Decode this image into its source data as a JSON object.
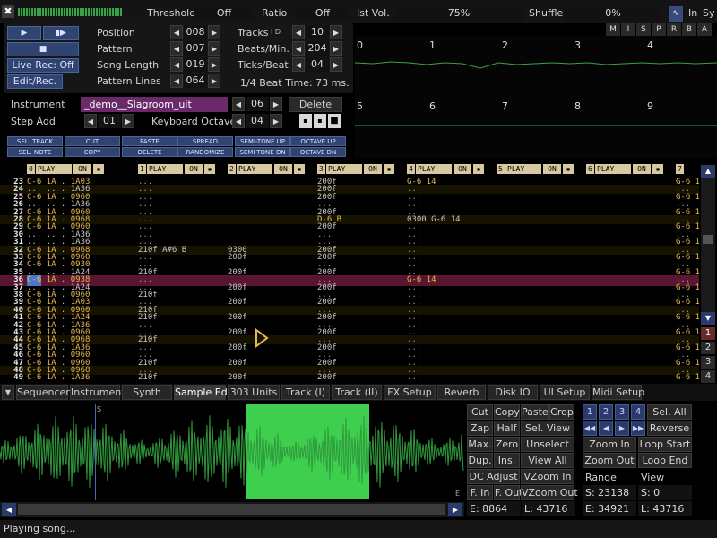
{
  "top_bar": {
    "threshold_label": "Threshold",
    "threshold_value": "Off",
    "ratio_label": "Ratio",
    "ratio_value": "Off",
    "inst_vol_label": "Ist Vol.",
    "inst_vol_value": "75%",
    "shuffle_label": "Shuffle",
    "shuffle_value": "0%",
    "in_label": "In",
    "sy_label": "Sy"
  },
  "transport": {
    "live_rec": "Live Rec: Off",
    "edit_rec": "Edit/Rec."
  },
  "song": {
    "position_label": "Position",
    "position_value": "008",
    "pattern_label": "Pattern",
    "pattern_value": "007",
    "song_length_label": "Song Length",
    "song_length_value": "019",
    "pattern_lines_label": "Pattern Lines",
    "pattern_lines_value": "064",
    "tracks_label": "Tracks",
    "tracks_id": "I D",
    "tracks_value": "10",
    "bpm_label": "Beats/Min.",
    "bpm_value": "204",
    "tpb_label": "Ticks/Beat",
    "tpb_value": "04",
    "beat_time": "1/4 Beat Time: 73 ms."
  },
  "mute_buttons": [
    "M",
    "I",
    "S",
    "P",
    "R",
    "B",
    "A"
  ],
  "scope_track_numbers_top": [
    "0",
    "1",
    "2",
    "3",
    "4"
  ],
  "scope_track_numbers_bottom": [
    "5",
    "6",
    "7",
    "8",
    "9"
  ],
  "instrument": {
    "label": "Instrument",
    "name": "_demo__Slagroom_uit",
    "number": "06",
    "delete": "Delete",
    "step_add_label": "Step Add",
    "step_add_value": "01",
    "kbd_octave_label": "Keyboard Octave",
    "kbd_octave_value": "04"
  },
  "edit_buttons": [
    {
      "top": "SEL. TRACK",
      "bottom": "SEL. NOTE"
    },
    {
      "top": "CUT",
      "bottom": "COPY"
    },
    {
      "top": "PASTE",
      "bottom": "DELETE"
    },
    {
      "top": "SPREAD",
      "bottom": "RANDOMIZE"
    },
    {
      "top": "SEMI-TONE UP",
      "bottom": "SEMI-TONE DN"
    },
    {
      "top": "OCTAVE UP",
      "bottom": "OCTAVE DN"
    }
  ],
  "track_headers": [
    {
      "num": "0",
      "play": "PLAY",
      "on": "ON"
    },
    {
      "num": "1",
      "play": "PLAY",
      "on": "ON"
    },
    {
      "num": "2",
      "play": "PLAY",
      "on": "ON"
    },
    {
      "num": "3",
      "play": "PLAY",
      "on": "ON"
    },
    {
      "num": "4",
      "play": "PLAY",
      "on": "ON"
    },
    {
      "num": "5",
      "play": "PLAY",
      "on": "ON"
    },
    {
      "num": "6",
      "play": "PLAY",
      "on": "ON"
    },
    {
      "num": "7",
      "play": "",
      "on": ""
    }
  ],
  "pattern_rows": [
    {
      "n": "23",
      "c0": "C-6 1A . 1A03",
      "c2": "...",
      "c4": "200f",
      "c5": "G-6 14",
      "c7": "G-6 1"
    },
    {
      "n": "24",
      "c0": "... .. . 1A36",
      "c2": "...",
      "c4": "200f",
      "c5": "...",
      "c7": "..."
    },
    {
      "n": "25",
      "c0": "C-6 1A . 0960",
      "c2": "...",
      "c4": "200f",
      "c5": "...",
      "c7": "G-6 1"
    },
    {
      "n": "26",
      "c0": "... .. . 1A36",
      "c2": "...",
      "c4": "...",
      "c5": "...",
      "c7": "..."
    },
    {
      "n": "27",
      "c0": "C-6 1A . 0960",
      "c2": "...",
      "c4": "200f",
      "c5": "...",
      "c7": "G-6 1"
    },
    {
      "n": "28",
      "c0": "C-6 1A . 0968",
      "c2": "...",
      "c4": "D-6 B",
      "c5": "0300 G-6 14",
      "c7": "..."
    },
    {
      "n": "29",
      "c0": "C-6 1A . 0960",
      "c2": "...",
      "c4": "200f",
      "c5": "...",
      "c7": "G-6 1"
    },
    {
      "n": "30",
      "c0": "... .. . 1A36",
      "c2": "...",
      "c4": "...",
      "c5": "...",
      "c7": "..."
    },
    {
      "n": "31",
      "c0": "... .. . 1A36",
      "c2": "...",
      "c4": "...",
      "c5": "...",
      "c7": "G-6 1"
    },
    {
      "n": "32",
      "c0": "C-6 1A . 0968",
      "c2": "210f A#6 B",
      "c3": "0300",
      "c4": "200f",
      "c5": "...",
      "c7": "..."
    },
    {
      "n": "33",
      "c0": "C-6 1A . 0960",
      "c2": "...",
      "c3": "200f",
      "c4": "200f",
      "c5": "...",
      "c7": "G-6 1"
    },
    {
      "n": "34",
      "c0": "C-6 1A . 0930",
      "c2": "...",
      "c4": "...",
      "c5": "...",
      "c7": "..."
    },
    {
      "n": "35",
      "c0": "... .. . 1A24",
      "c2": "210f",
      "c3": "200f",
      "c4": "200f",
      "c5": "...",
      "c7": "G-6 1"
    },
    {
      "n": "36",
      "c0": "C-6 1A . 0938",
      "c2": "...",
      "c4": "...",
      "c5": "G-6 14",
      "c7": "..."
    },
    {
      "n": "37",
      "c0": "... .. . 1A24",
      "c2": "...",
      "c3": "200f",
      "c4": "200f",
      "c5": "...",
      "c7": "G-6 1"
    },
    {
      "n": "38",
      "c0": "C-6 1A . 0960",
      "c2": "210f",
      "c4": "...",
      "c5": "...",
      "c7": "..."
    },
    {
      "n": "39",
      "c0": "C-6 1A . 1A03",
      "c2": "...",
      "c3": "200f",
      "c4": "200f",
      "c5": "...",
      "c7": "G-6 1"
    },
    {
      "n": "40",
      "c0": "C-6 1A . 0960",
      "c2": "210f",
      "c4": "...",
      "c5": "...",
      "c7": "..."
    },
    {
      "n": "41",
      "c0": "C-6 1A . 1A24",
      "c2": "210f",
      "c3": "200f",
      "c4": "200f",
      "c5": "...",
      "c7": "G-6 1"
    },
    {
      "n": "42",
      "c0": "C-6 1A . 1A36",
      "c2": "...",
      "c4": "...",
      "c5": "...",
      "c7": "..."
    },
    {
      "n": "43",
      "c0": "C-6 1A . 0960",
      "c2": "...",
      "c3": "200f",
      "c4": "200f",
      "c5": "...",
      "c7": "G-6 1"
    },
    {
      "n": "44",
      "c0": "C-6 1A . 0968",
      "c2": "210f",
      "c4": "...",
      "c5": "...",
      "c7": "..."
    },
    {
      "n": "45",
      "c0": "C-6 1A . 1A36",
      "c2": "...",
      "c3": "200f",
      "c4": "200f",
      "c5": "...",
      "c7": "G-6 1"
    },
    {
      "n": "46",
      "c0": "C-6 1A . 0960",
      "c2": "...",
      "c4": "...",
      "c5": "...",
      "c7": "..."
    },
    {
      "n": "47",
      "c0": "C-6 1A . 0960",
      "c2": "210f",
      "c3": "200f",
      "c4": "200f",
      "c5": "...",
      "c7": "G-6 1"
    },
    {
      "n": "48",
      "c0": "C-6 1A . 0968",
      "c2": "...",
      "c4": "...",
      "c5": "...",
      "c7": "..."
    },
    {
      "n": "49",
      "c0": "C-6 1A . 1A36",
      "c2": "210f",
      "c3": "200f",
      "c4": "200f",
      "c5": "...",
      "c7": "G-6 1"
    }
  ],
  "current_row": "36",
  "pattern_side_numbers": [
    "1",
    "2",
    "3",
    "4"
  ],
  "tabs": [
    "Sequencer",
    "Instrument",
    "Synth",
    "Sample Ed.",
    "303 Units",
    "Track (I)",
    "Track (II)",
    "FX Setup",
    "Reverb",
    "Disk IO",
    "UI Setup",
    "Midi Setup"
  ],
  "active_tab": "Sample Ed.",
  "sample_editor": {
    "start_marker": "S",
    "end_marker": "E",
    "buttons": {
      "cut": "Cut",
      "copy": "Copy",
      "paste": "Paste",
      "crop": "Crop",
      "zap": "Zap",
      "half": "Half",
      "sel_view": "Sel. View",
      "max": "Max.",
      "zero": "Zero",
      "unselect": "Unselect",
      "dup": "Dup.",
      "ins": "Ins.",
      "view_all": "View All",
      "dc_adjust": "DC Adjust",
      "vzoom_in": "VZoom In",
      "f_in": "F. In",
      "f_out": "F. Out",
      "vzoom_out": "VZoom Out",
      "sel_all": "Sel. All",
      "reverse": "Reverse",
      "zoom_in": "Zoom In",
      "loop_start": "Loop Start",
      "zoom_out": "Zoom Out",
      "loop_end": "Loop End"
    },
    "pages": [
      "1",
      "2",
      "3",
      "4"
    ],
    "range_label": "Range",
    "view_label": "View",
    "range_s": "S: 23138",
    "range_e": "E: 34921",
    "view_s": "S: 0",
    "view_e": "L: 43716",
    "sel_e": "E: 8864",
    "sel_l": "L: 43716"
  },
  "status": "Playing song..."
}
